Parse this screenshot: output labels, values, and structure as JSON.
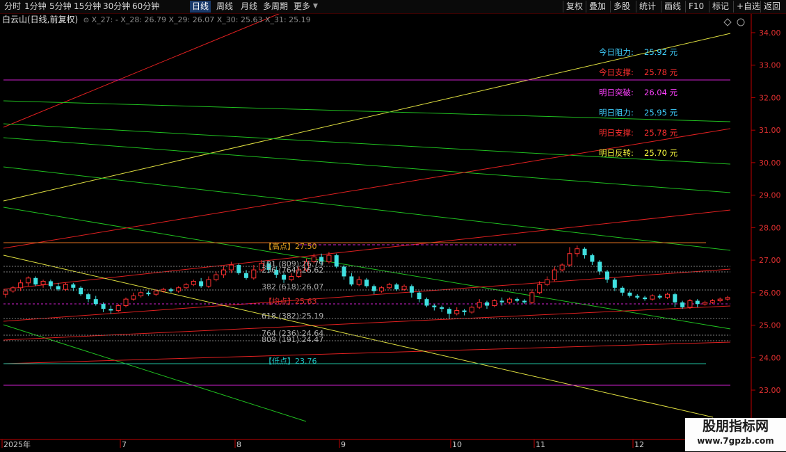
{
  "toolbar": {
    "periods": [
      "分时",
      "1分钟",
      "5分钟",
      "15分钟",
      "30分钟",
      "60分钟",
      "日线",
      "周线",
      "月线",
      "多周期",
      "更多"
    ],
    "active_period": "日线",
    "right_buttons": [
      "复权",
      "叠加",
      "多股",
      "统计",
      "画线",
      "F10",
      "标记",
      "+自选",
      "返回"
    ]
  },
  "infobar": {
    "title": "白云山(日线,前复权)",
    "indicators": "X_27: -  X_28: 26.79  X_29: 26.07  X_30: 25.63  X_31: 25.19"
  },
  "y_axis": {
    "ticks": [
      "34.00",
      "33.00",
      "32.00",
      "31.00",
      "30.00",
      "29.00",
      "28.00",
      "27.00",
      "26.00",
      "25.00",
      "24.00",
      "23.00"
    ]
  },
  "x_axis": {
    "labels": [
      "2025年",
      "7",
      "8",
      "9",
      "10",
      "11",
      "12"
    ]
  },
  "fib_labels": {
    "high": "【高点】27.50",
    "l191": "191 (809):26.79",
    "l236": "236 (764):26.62",
    "l382": "382 (618):26.07",
    "l500": "【均点】25.63",
    "l618": "618 (382):25.19",
    "l764": "764 (236):24.64",
    "l809": "809 (191):24.47",
    "low": "【低点】23.76"
  },
  "panel": [
    {
      "label": "今日阻力:",
      "value": "25.92 元",
      "color": "#40d0ff"
    },
    {
      "label": "今日支撑:",
      "value": "25.78 元",
      "color": "#ff3030"
    },
    {
      "label": "明日突破:",
      "value": "26.04 元",
      "color": "#ff40ff"
    },
    {
      "label": "明日阻力:",
      "value": "25.95 元",
      "color": "#40d0ff"
    },
    {
      "label": "明日支撑:",
      "value": "25.78 元",
      "color": "#ff3030"
    },
    {
      "label": "明日反转:",
      "value": "25.70 元",
      "color": "#ffff40"
    }
  ],
  "colors": {
    "up": "#ff3030",
    "down": "#40e0e0",
    "axis": "#c00000",
    "green": "#20c020",
    "red": "#e02020",
    "yellow": "#e0e040",
    "magenta": "#d020d0"
  },
  "chart_data": {
    "type": "candlestick",
    "ylim": [
      22.6,
      34.3
    ],
    "candles": [
      [
        25.95,
        26.05,
        25.85,
        26.1
      ],
      [
        26.05,
        26.15,
        26.0,
        26.2
      ],
      [
        26.15,
        26.3,
        26.05,
        26.4
      ],
      [
        26.3,
        26.45,
        26.2,
        26.5
      ],
      [
        26.45,
        26.25,
        26.2,
        26.5
      ],
      [
        26.25,
        26.35,
        26.15,
        26.4
      ],
      [
        26.35,
        26.2,
        26.1,
        26.4
      ],
      [
        26.2,
        26.1,
        26.05,
        26.3
      ],
      [
        26.1,
        26.25,
        26.05,
        26.3
      ],
      [
        26.25,
        26.15,
        26.05,
        26.3
      ],
      [
        26.15,
        25.95,
        25.9,
        26.2
      ],
      [
        25.95,
        25.8,
        25.7,
        26.0
      ],
      [
        25.8,
        25.65,
        25.6,
        25.9
      ],
      [
        25.65,
        25.5,
        25.4,
        25.7
      ],
      [
        25.5,
        25.45,
        25.35,
        25.6
      ],
      [
        25.45,
        25.6,
        25.4,
        25.65
      ],
      [
        25.6,
        25.8,
        25.55,
        25.85
      ],
      [
        25.8,
        25.9,
        25.75,
        26.0
      ],
      [
        25.9,
        26.0,
        25.85,
        26.05
      ],
      [
        26.0,
        25.95,
        25.9,
        26.05
      ],
      [
        25.95,
        26.05,
        25.9,
        26.1
      ],
      [
        26.05,
        26.1,
        26.0,
        26.15
      ],
      [
        26.1,
        26.05,
        26.0,
        26.15
      ],
      [
        26.05,
        26.15,
        26.0,
        26.2
      ],
      [
        26.15,
        26.25,
        26.1,
        26.3
      ],
      [
        26.25,
        26.35,
        26.2,
        26.4
      ],
      [
        26.35,
        26.2,
        26.15,
        26.45
      ],
      [
        26.2,
        26.4,
        26.15,
        26.5
      ],
      [
        26.4,
        26.55,
        26.35,
        26.65
      ],
      [
        26.55,
        26.7,
        26.45,
        26.8
      ],
      [
        26.7,
        26.85,
        26.6,
        26.95
      ],
      [
        26.85,
        26.6,
        26.55,
        26.9
      ],
      [
        26.6,
        26.45,
        26.4,
        26.7
      ],
      [
        26.45,
        26.7,
        26.4,
        26.85
      ],
      [
        26.7,
        26.9,
        26.65,
        27.0
      ],
      [
        26.9,
        26.7,
        26.6,
        26.95
      ],
      [
        26.7,
        26.55,
        26.45,
        26.8
      ],
      [
        26.55,
        26.4,
        26.3,
        26.6
      ],
      [
        26.4,
        26.5,
        26.35,
        26.6
      ],
      [
        26.5,
        26.7,
        26.45,
        26.8
      ],
      [
        26.7,
        26.95,
        26.65,
        27.05
      ],
      [
        26.95,
        27.1,
        26.9,
        27.2
      ],
      [
        27.1,
        26.95,
        26.85,
        27.2
      ],
      [
        26.95,
        27.15,
        26.9,
        27.25
      ],
      [
        27.15,
        26.8,
        26.75,
        27.2
      ],
      [
        26.8,
        26.5,
        26.4,
        26.85
      ],
      [
        26.5,
        26.25,
        26.2,
        26.6
      ],
      [
        26.25,
        26.4,
        26.2,
        26.5
      ],
      [
        26.4,
        26.2,
        26.15,
        26.45
      ],
      [
        26.2,
        26.05,
        25.95,
        26.25
      ],
      [
        26.05,
        26.15,
        26.0,
        26.2
      ],
      [
        26.15,
        26.25,
        26.1,
        26.3
      ],
      [
        26.25,
        26.1,
        26.05,
        26.3
      ],
      [
        26.1,
        26.2,
        26.05,
        26.25
      ],
      [
        26.2,
        26.0,
        25.85,
        26.25
      ],
      [
        26.0,
        25.8,
        25.7,
        26.05
      ],
      [
        25.8,
        25.6,
        25.55,
        25.85
      ],
      [
        25.6,
        25.55,
        25.45,
        25.65
      ],
      [
        25.55,
        25.5,
        25.4,
        25.6
      ],
      [
        25.5,
        25.35,
        25.2,
        25.55
      ],
      [
        25.35,
        25.45,
        25.3,
        25.55
      ],
      [
        25.45,
        25.4,
        25.3,
        25.5
      ],
      [
        25.4,
        25.55,
        25.35,
        25.6
      ],
      [
        25.55,
        25.7,
        25.5,
        25.8
      ],
      [
        25.7,
        25.6,
        25.5,
        25.75
      ],
      [
        25.6,
        25.75,
        25.55,
        25.8
      ],
      [
        25.75,
        25.7,
        25.6,
        25.85
      ],
      [
        25.7,
        25.8,
        25.65,
        25.85
      ],
      [
        25.8,
        25.75,
        25.7,
        25.85
      ],
      [
        25.75,
        25.7,
        25.65,
        25.8
      ],
      [
        25.7,
        26.0,
        25.65,
        26.1
      ],
      [
        26.0,
        26.25,
        25.95,
        26.35
      ],
      [
        26.25,
        26.4,
        26.2,
        26.5
      ],
      [
        26.4,
        26.7,
        26.35,
        26.8
      ],
      [
        26.7,
        26.85,
        26.65,
        26.9
      ],
      [
        26.85,
        27.2,
        26.8,
        27.4
      ],
      [
        27.2,
        27.35,
        27.1,
        27.45
      ],
      [
        27.35,
        27.15,
        27.05,
        27.4
      ],
      [
        27.15,
        26.95,
        26.85,
        27.2
      ],
      [
        26.95,
        26.65,
        26.55,
        27.0
      ],
      [
        26.65,
        26.4,
        26.3,
        26.7
      ],
      [
        26.4,
        26.15,
        26.05,
        26.45
      ],
      [
        26.15,
        26.0,
        25.9,
        26.2
      ],
      [
        26.0,
        25.9,
        25.85,
        26.05
      ],
      [
        25.9,
        25.85,
        25.8,
        25.95
      ],
      [
        25.85,
        25.8,
        25.75,
        25.9
      ],
      [
        25.8,
        25.9,
        25.75,
        25.95
      ],
      [
        25.9,
        25.85,
        25.8,
        25.95
      ],
      [
        25.85,
        25.95,
        25.8,
        26.0
      ],
      [
        25.95,
        25.7,
        25.55,
        26.0
      ],
      [
        25.7,
        25.55,
        25.5,
        25.75
      ],
      [
        25.55,
        25.75,
        25.5,
        25.8
      ],
      [
        25.75,
        25.65,
        25.55,
        25.8
      ],
      [
        25.65,
        25.7,
        25.6,
        25.75
      ],
      [
        25.7,
        25.75,
        25.65,
        25.8
      ],
      [
        25.75,
        25.8,
        25.7,
        25.85
      ],
      [
        25.8,
        25.85,
        25.75,
        25.9
      ]
    ]
  }
}
